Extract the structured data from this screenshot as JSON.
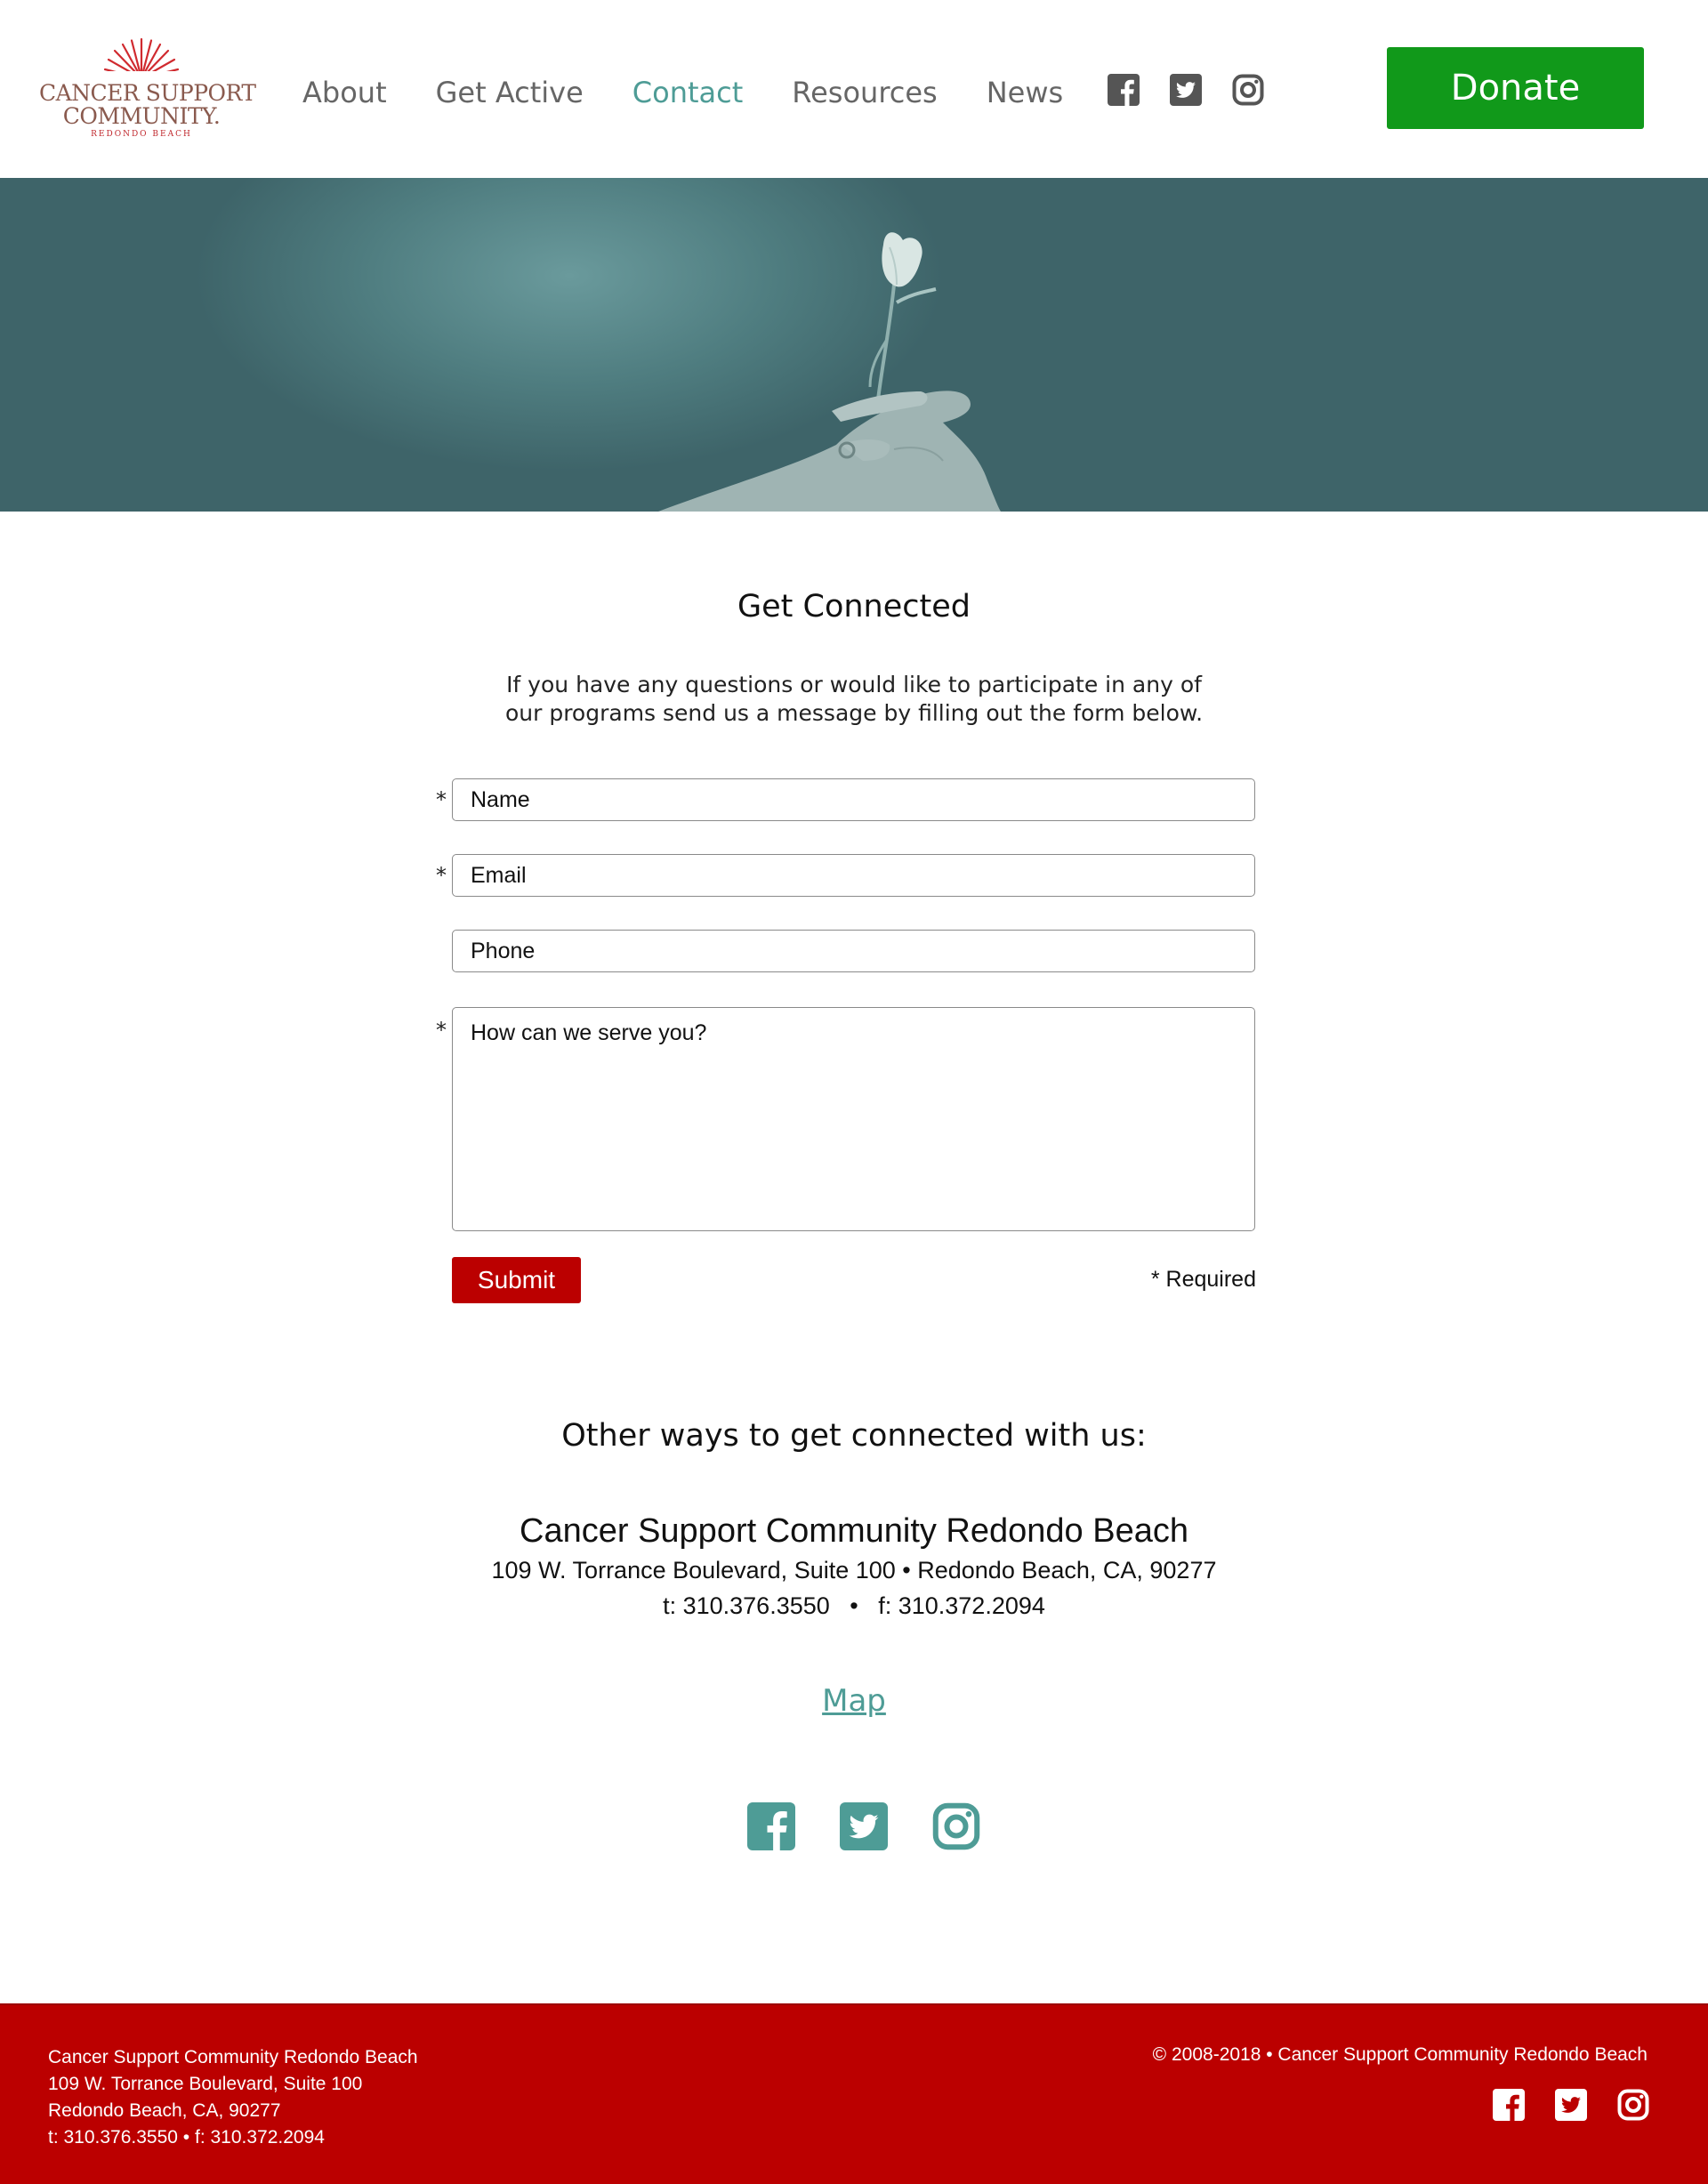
{
  "brand": {
    "logo_line1": "CANCER SUPPORT",
    "logo_line2": "COMMUNITY.",
    "logo_line3": "REDONDO BEACH",
    "accent_teal": "#4e9c96",
    "brand_red": "#bb0000",
    "donate_green": "#11991a"
  },
  "nav": {
    "items": [
      {
        "label": "About",
        "active": false
      },
      {
        "label": "Get Active",
        "active": false
      },
      {
        "label": "Contact",
        "active": true
      },
      {
        "label": "Resources",
        "active": false
      },
      {
        "label": "News",
        "active": false
      }
    ],
    "social_icons": [
      "facebook-icon",
      "twitter-icon",
      "instagram-icon"
    ],
    "donate_label": "Donate"
  },
  "contact_form": {
    "title": "Get Connected",
    "intro_line1": "If you have any questions or would like to participate in any of",
    "intro_line2": "our programs send us a message by filling out the form below.",
    "required_marker": "*",
    "name_placeholder": "Name",
    "name_value": "",
    "email_placeholder": "Email",
    "email_value": "",
    "phone_placeholder": "Phone",
    "phone_value": "",
    "message_placeholder": "How can we serve you?",
    "message_value": "",
    "submit_label": "Submit",
    "required_note": "* Required"
  },
  "other_ways": {
    "title": "Other ways to get connected with us:",
    "org_name": "Cancer Support Community Redondo Beach",
    "address": "109 W. Torrance Boulevard, Suite 100 • Redondo Beach, CA, 90277",
    "phones": "t: 310.376.3550   •   f: 310.372.2094",
    "map_label": "Map",
    "social_icons": [
      "facebook-icon",
      "twitter-icon",
      "instagram-icon"
    ]
  },
  "footer": {
    "address_line1": "Cancer Support Community Redondo Beach",
    "address_line2": "109 W. Torrance Boulevard, Suite 100",
    "address_line3": "Redondo Beach, CA, 90277",
    "address_line4": "t: 310.376.3550 • f: 310.372.2094",
    "copyright": "© 2008-2018 • Cancer Support Community Redondo Beach",
    "social_icons": [
      "facebook-icon",
      "twitter-icon",
      "instagram-icon"
    ]
  }
}
